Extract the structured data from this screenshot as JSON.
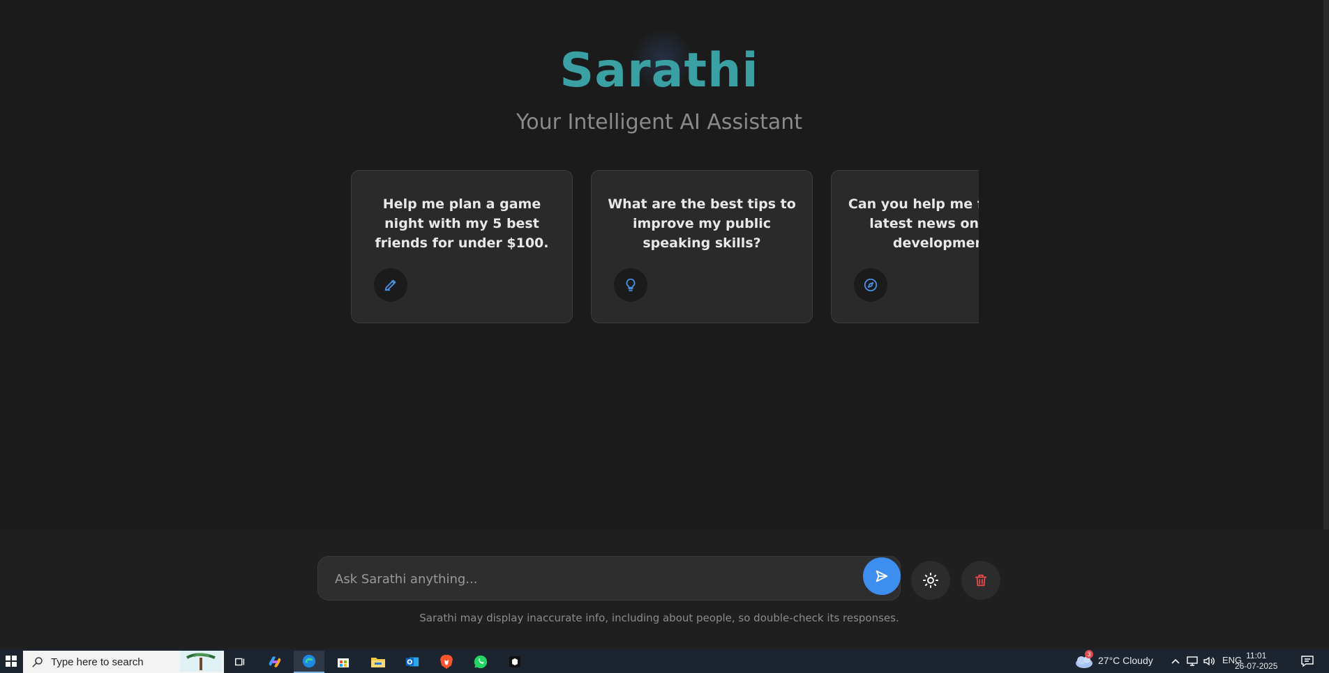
{
  "app": {
    "title": "Sarathi",
    "subtitle": "Your Intelligent AI Assistant",
    "brand_color": "#3aa0a3",
    "accent_color": "#3e8ef0"
  },
  "suggestions": [
    {
      "text": "Help me plan a game night with my 5 best friends for under $100.",
      "icon": "pencil-icon"
    },
    {
      "text": "What are the best tips to improve my public speaking skills?",
      "icon": "lightbulb-icon"
    },
    {
      "text": "Can you help me find the latest news on web development",
      "icon": "compass-icon"
    }
  ],
  "composer": {
    "placeholder": "Ask Sarathi anything...",
    "send_icon": "send-icon",
    "theme_icon": "sun-icon",
    "delete_icon": "trash-icon"
  },
  "disclaimer": "Sarathi may display inaccurate info, including about people, so double-check its responses.",
  "taskbar": {
    "search_placeholder": "Type here to search",
    "apps": [
      "task-view-icon",
      "copilot-icon",
      "edge-icon",
      "store-icon",
      "file-explorer-icon",
      "outlook-icon",
      "brave-icon",
      "whatsapp-icon",
      "app-icon"
    ],
    "weather": "27°C  Cloudy",
    "weather_badge": "3",
    "language": "ENG",
    "time": "11:01",
    "date": "26-07-2025"
  }
}
